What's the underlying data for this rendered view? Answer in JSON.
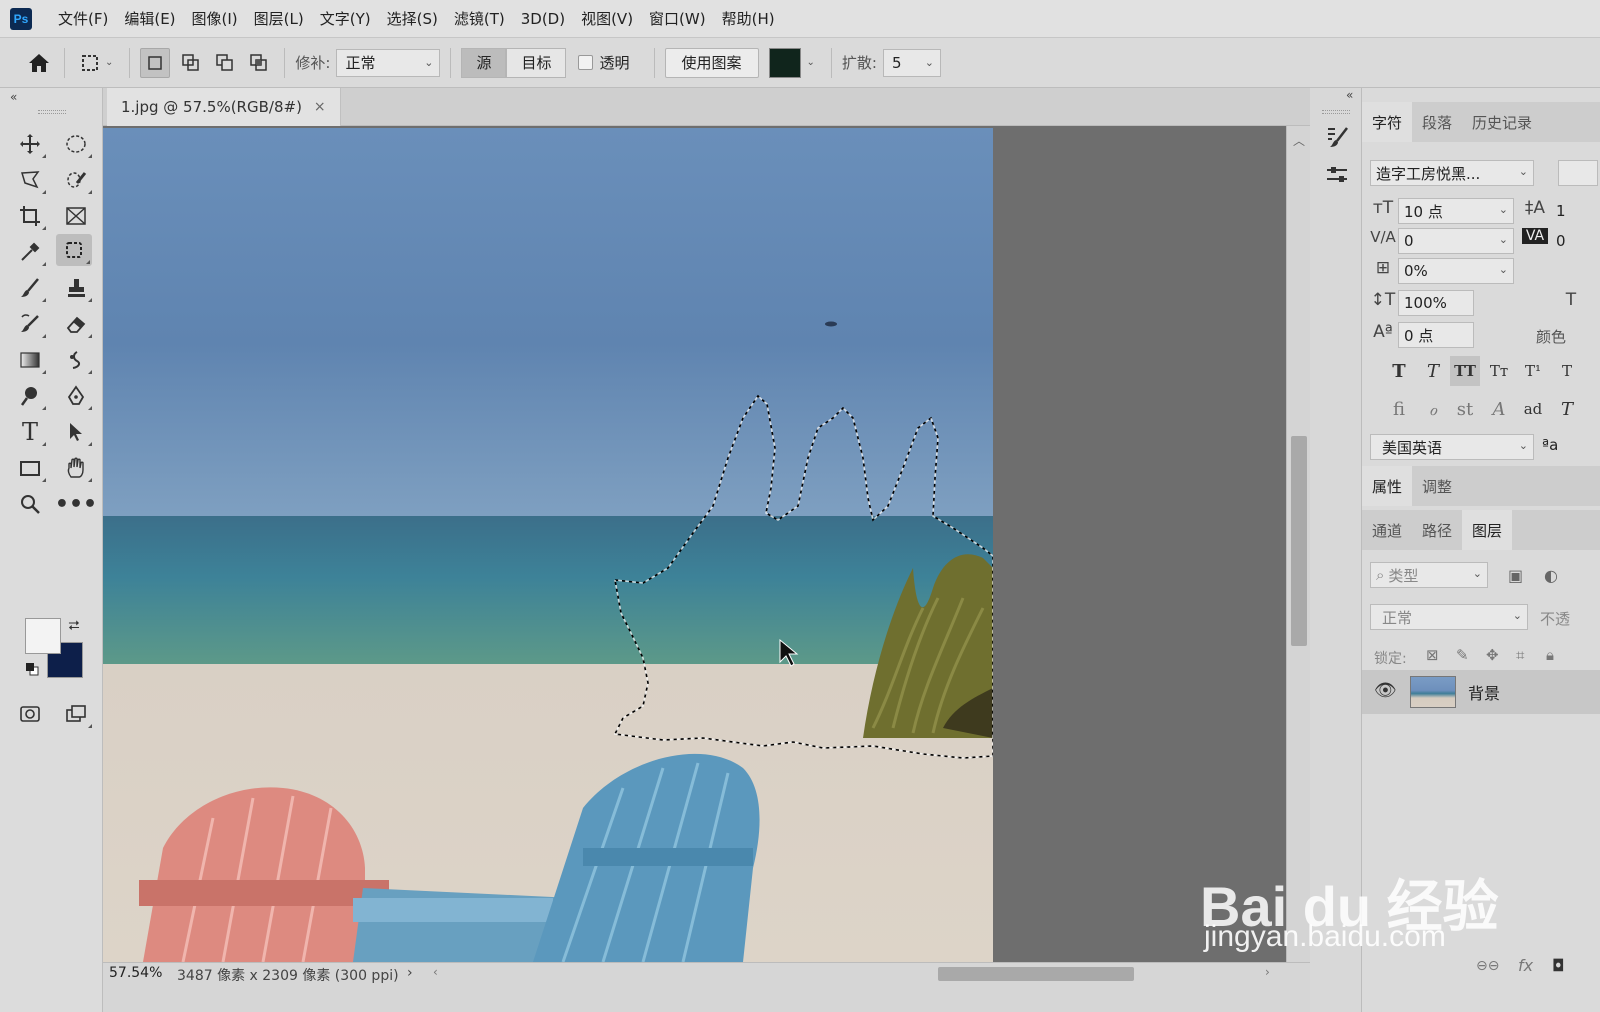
{
  "app": {
    "logo": "Ps"
  },
  "menu": [
    "文件(F)",
    "编辑(E)",
    "图像(I)",
    "图层(L)",
    "文字(Y)",
    "选择(S)",
    "滤镜(T)",
    "3D(D)",
    "视图(V)",
    "窗口(W)",
    "帮助(H)"
  ],
  "options": {
    "patch_label": "修补:",
    "patch_mode": "正常",
    "source_label": "源",
    "target_label": "目标",
    "transparent_label": "透明",
    "use_pattern_label": "使用图案",
    "diffusion_label": "扩散:",
    "diffusion_value": "5"
  },
  "document": {
    "tab_title": "1.jpg @ 57.5%(RGB/8#)",
    "close": "×"
  },
  "status": {
    "zoom": "57.54%",
    "info": "3487 像素 x 2309 像素 (300 ppi)",
    "arrow": "›"
  },
  "character_panel": {
    "tabs": [
      "字符",
      "段落",
      "历史记录"
    ],
    "font_family": "造字工房悦黑...",
    "font_size": "10 点",
    "kerning": "0",
    "tracking_scale": "0%",
    "vertical_scale": "100%",
    "baseline_shift": "0 点",
    "leading_partial": "1",
    "tracking_partial": "0",
    "color_label": "颜色",
    "language": "美国英语",
    "aa_label": "ªa"
  },
  "props_panel": {
    "tabs": [
      "属性",
      "调整"
    ]
  },
  "layers_panel": {
    "tabs": [
      "通道",
      "路径",
      "图层"
    ],
    "filter_placeholder": "类型",
    "blend_mode": "正常",
    "opacity_label": "不透",
    "lock_label": "锁定:",
    "layers": [
      {
        "name": "背景",
        "visible": true
      }
    ]
  },
  "watermark": {
    "logo": "Bai du 经验",
    "url": "jingyan.baidu.com"
  },
  "colors": {
    "foreground": "#f3f3f3",
    "background": "#0d1f4a",
    "pattern_swatch": "#10251c"
  }
}
